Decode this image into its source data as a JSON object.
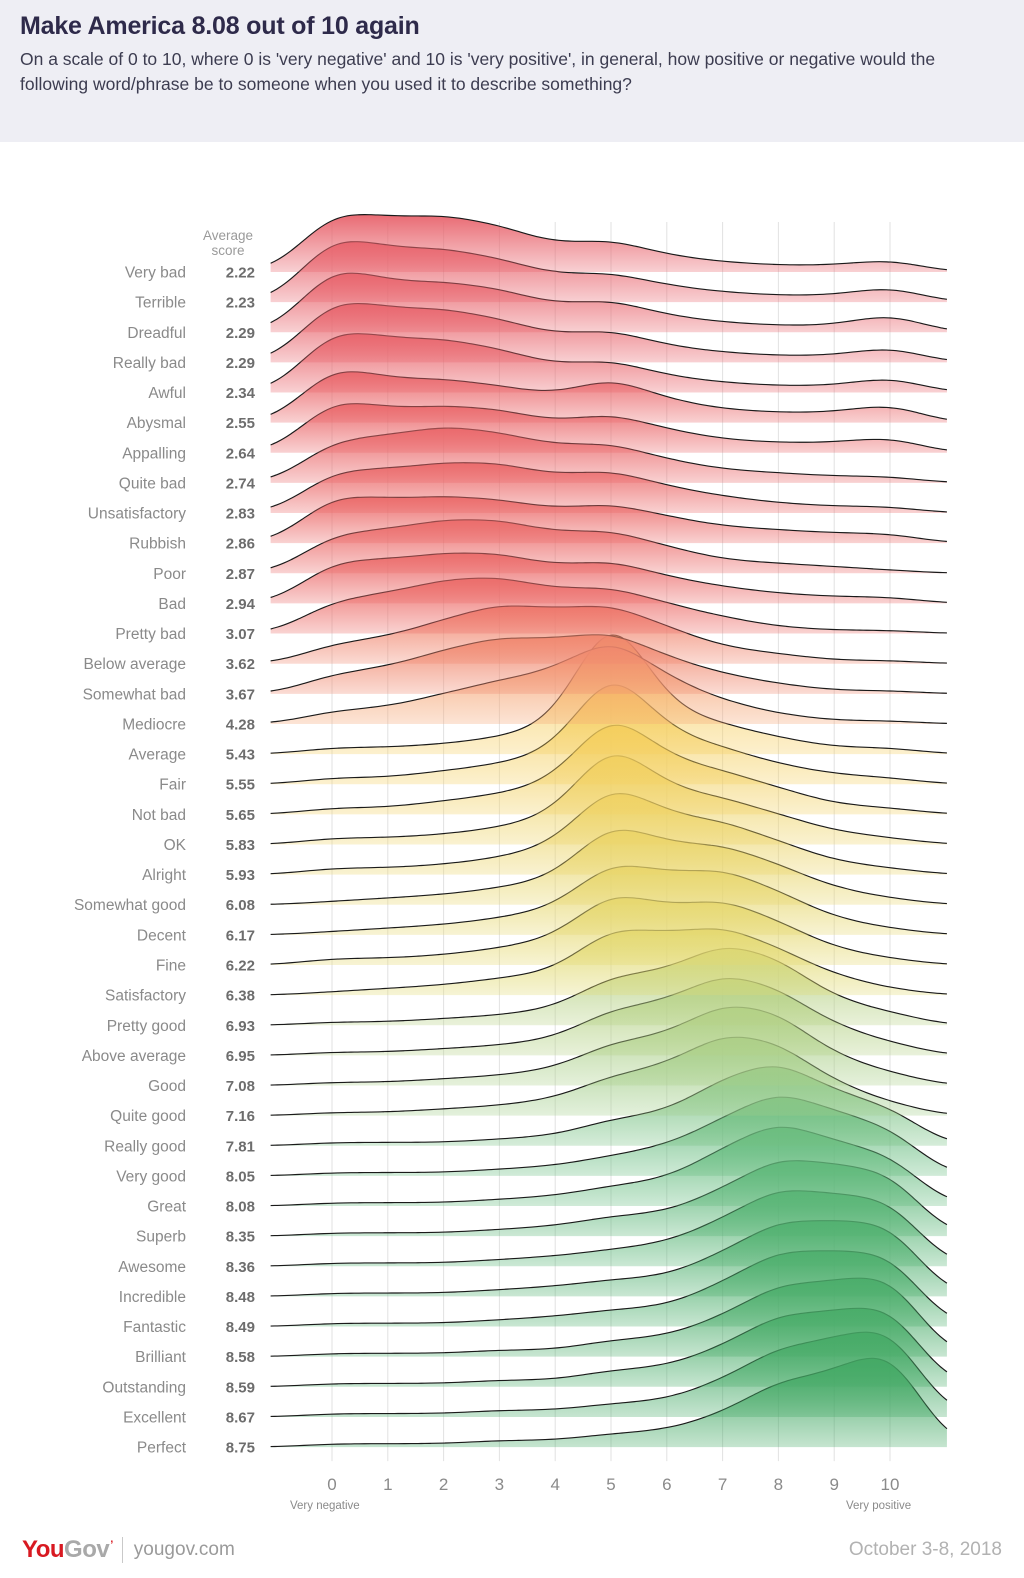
{
  "header": {
    "title": "Make America 8.08 out of 10 again",
    "subtitle": "On a scale of 0 to 10, where 0 is 'very negative' and 10 is 'very positive', in general, how positive or negative would the following word/phrase be to someone when you used it to describe something?"
  },
  "columns": {
    "average_score_line1": "Average",
    "average_score_line2": "score"
  },
  "axis": {
    "ticks": [
      "0",
      "1",
      "2",
      "3",
      "4",
      "5",
      "6",
      "7",
      "8",
      "9",
      "10"
    ],
    "left_label": "Very negative",
    "right_label": "Very positive",
    "min": 0,
    "max": 10
  },
  "footer": {
    "logo_you": "You",
    "logo_gov": "Gov",
    "logo_tm": "’",
    "site": "yougov.com",
    "date": "October 3-8, 2018"
  },
  "colors": {
    "header_bg": "#eeeef4",
    "title": "#2e2a4a",
    "negative": "#e8636c",
    "neutral": "#f2c744",
    "positive": "#3ba45e",
    "brand_red": "#d81921",
    "grid": "#e2e2e2",
    "stroke": "#1a1a1a"
  },
  "chart_data": {
    "type": "area",
    "title": "Make America 8.08 out of 10 again",
    "xlabel": "",
    "ylabel": "",
    "xlim": [
      0,
      10
    ],
    "grid": true,
    "legend": false,
    "note": "Ridgeline / joyplot of response distributions (0-10) for each word or phrase. values = share of respondents choosing each score 0 through 10.",
    "categories": [
      "0",
      "1",
      "2",
      "3",
      "4",
      "5",
      "6",
      "7",
      "8",
      "9",
      "10"
    ],
    "series": [
      {
        "name": "Very bad",
        "average": 2.22,
        "values": [
          19,
          16,
          17,
          14,
          8,
          10,
          5,
          3,
          2,
          2,
          4
        ]
      },
      {
        "name": "Terrible",
        "average": 2.23,
        "values": [
          21,
          16,
          16,
          13,
          8,
          9,
          5,
          3,
          2,
          2,
          5
        ]
      },
      {
        "name": "Dreadful",
        "average": 2.29,
        "values": [
          21,
          15,
          15,
          13,
          8,
          10,
          5,
          3,
          2,
          2,
          6
        ]
      },
      {
        "name": "Really bad",
        "average": 2.29,
        "values": [
          20,
          16,
          16,
          13,
          8,
          10,
          5,
          3,
          2,
          2,
          5
        ]
      },
      {
        "name": "Awful",
        "average": 2.34,
        "values": [
          20,
          16,
          16,
          13,
          8,
          10,
          5,
          3,
          2,
          2,
          5
        ]
      },
      {
        "name": "Abysmal",
        "average": 2.55,
        "values": [
          18,
          13,
          13,
          11,
          8,
          14,
          7,
          4,
          3,
          3,
          6
        ]
      },
      {
        "name": "Appalling",
        "average": 2.64,
        "values": [
          17,
          13,
          14,
          13,
          9,
          12,
          7,
          4,
          3,
          3,
          5
        ]
      },
      {
        "name": "Quite bad",
        "average": 2.74,
        "values": [
          13,
          14,
          17,
          15,
          11,
          12,
          7,
          4,
          3,
          2,
          2
        ]
      },
      {
        "name": "Unsatisfactory",
        "average": 2.83,
        "values": [
          13,
          13,
          15,
          15,
          11,
          13,
          8,
          5,
          3,
          2,
          2
        ]
      },
      {
        "name": "Rubbish",
        "average": 2.86,
        "values": [
          15,
          13,
          14,
          13,
          10,
          12,
          8,
          5,
          4,
          3,
          3
        ]
      },
      {
        "name": "Poor",
        "average": 2.87,
        "values": [
          12,
          13,
          16,
          16,
          12,
          13,
          8,
          4,
          3,
          2,
          1
        ]
      },
      {
        "name": "Bad",
        "average": 2.94,
        "values": [
          13,
          13,
          15,
          15,
          11,
          13,
          8,
          5,
          3,
          2,
          2
        ]
      },
      {
        "name": "Pretty bad",
        "average": 3.07,
        "values": [
          10,
          12,
          16,
          17,
          13,
          14,
          9,
          5,
          2,
          1,
          1
        ]
      },
      {
        "name": "Below average",
        "average": 3.62,
        "values": [
          6,
          8,
          13,
          18,
          16,
          18,
          11,
          5,
          3,
          1,
          1
        ]
      },
      {
        "name": "Somewhat bad",
        "average": 3.67,
        "values": [
          6,
          8,
          13,
          17,
          16,
          19,
          11,
          6,
          3,
          1,
          1
        ]
      },
      {
        "name": "Mediocre",
        "average": 4.28,
        "values": [
          4,
          5,
          9,
          13,
          16,
          27,
          14,
          7,
          3,
          1,
          1
        ]
      },
      {
        "name": "Average",
        "average": 5.43,
        "values": [
          2,
          2,
          3,
          5,
          9,
          48,
          14,
          9,
          5,
          2,
          2
        ]
      },
      {
        "name": "Fair",
        "average": 5.55,
        "values": [
          2,
          2,
          4,
          6,
          10,
          38,
          16,
          11,
          6,
          3,
          2
        ]
      },
      {
        "name": "Not bad",
        "average": 5.65,
        "values": [
          2,
          2,
          4,
          6,
          10,
          33,
          17,
          13,
          8,
          3,
          2
        ]
      },
      {
        "name": "OK",
        "average": 5.83,
        "values": [
          2,
          2,
          3,
          5,
          9,
          33,
          17,
          14,
          9,
          4,
          2
        ]
      },
      {
        "name": "Alright",
        "average": 5.93,
        "values": [
          2,
          2,
          3,
          5,
          9,
          29,
          18,
          16,
          10,
          4,
          2
        ]
      },
      {
        "name": "Somewhat good",
        "average": 6.08,
        "values": [
          1,
          2,
          3,
          5,
          8,
          26,
          18,
          18,
          12,
          5,
          2
        ]
      },
      {
        "name": "Decent",
        "average": 6.17,
        "values": [
          1,
          2,
          3,
          5,
          8,
          23,
          18,
          20,
          13,
          5,
          2
        ]
      },
      {
        "name": "Fine",
        "average": 6.22,
        "values": [
          2,
          2,
          3,
          5,
          8,
          23,
          17,
          20,
          13,
          5,
          2
        ]
      },
      {
        "name": "Satisfactory",
        "average": 6.38,
        "values": [
          1,
          2,
          3,
          5,
          7,
          21,
          18,
          21,
          14,
          6,
          2
        ]
      },
      {
        "name": "Pretty good",
        "average": 6.93,
        "values": [
          1,
          1,
          2,
          3,
          5,
          15,
          16,
          25,
          20,
          8,
          4
        ]
      },
      {
        "name": "Above average",
        "average": 6.95,
        "values": [
          1,
          1,
          2,
          3,
          5,
          14,
          16,
          25,
          20,
          9,
          4
        ]
      },
      {
        "name": "Good",
        "average": 7.08,
        "values": [
          1,
          1,
          2,
          3,
          5,
          13,
          15,
          25,
          22,
          9,
          4
        ]
      },
      {
        "name": "Quite good",
        "average": 7.16,
        "values": [
          1,
          1,
          2,
          3,
          5,
          12,
          15,
          25,
          22,
          10,
          4
        ]
      },
      {
        "name": "Really good",
        "average": 7.81,
        "values": [
          1,
          1,
          1,
          2,
          3,
          8,
          10,
          20,
          26,
          16,
          12
        ]
      },
      {
        "name": "Very good",
        "average": 8.05,
        "values": [
          1,
          1,
          1,
          2,
          3,
          6,
          9,
          17,
          26,
          19,
          15
        ]
      },
      {
        "name": "Great",
        "average": 8.08,
        "values": [
          1,
          1,
          1,
          2,
          3,
          6,
          8,
          17,
          26,
          19,
          16
        ]
      },
      {
        "name": "Superb",
        "average": 8.35,
        "values": [
          1,
          1,
          1,
          2,
          3,
          6,
          7,
          14,
          24,
          21,
          20
        ]
      },
      {
        "name": "Awesome",
        "average": 8.36,
        "values": [
          1,
          1,
          1,
          2,
          3,
          5,
          7,
          14,
          24,
          21,
          21
        ]
      },
      {
        "name": "Incredible",
        "average": 8.48,
        "values": [
          1,
          1,
          1,
          2,
          3,
          5,
          6,
          13,
          23,
          22,
          23
        ]
      },
      {
        "name": "Fantastic",
        "average": 8.49,
        "values": [
          1,
          1,
          1,
          2,
          3,
          5,
          6,
          13,
          23,
          22,
          23
        ]
      },
      {
        "name": "Brilliant",
        "average": 8.58,
        "values": [
          1,
          1,
          1,
          2,
          2,
          5,
          6,
          12,
          22,
          22,
          26
        ]
      },
      {
        "name": "Outstanding",
        "average": 8.59,
        "values": [
          1,
          1,
          1,
          2,
          2,
          5,
          6,
          12,
          22,
          22,
          26
        ]
      },
      {
        "name": "Excellent",
        "average": 8.67,
        "values": [
          1,
          1,
          1,
          2,
          2,
          4,
          5,
          11,
          21,
          23,
          29
        ]
      },
      {
        "name": "Perfect",
        "average": 8.75,
        "values": [
          1,
          1,
          1,
          2,
          2,
          4,
          5,
          10,
          20,
          22,
          32
        ]
      }
    ]
  }
}
